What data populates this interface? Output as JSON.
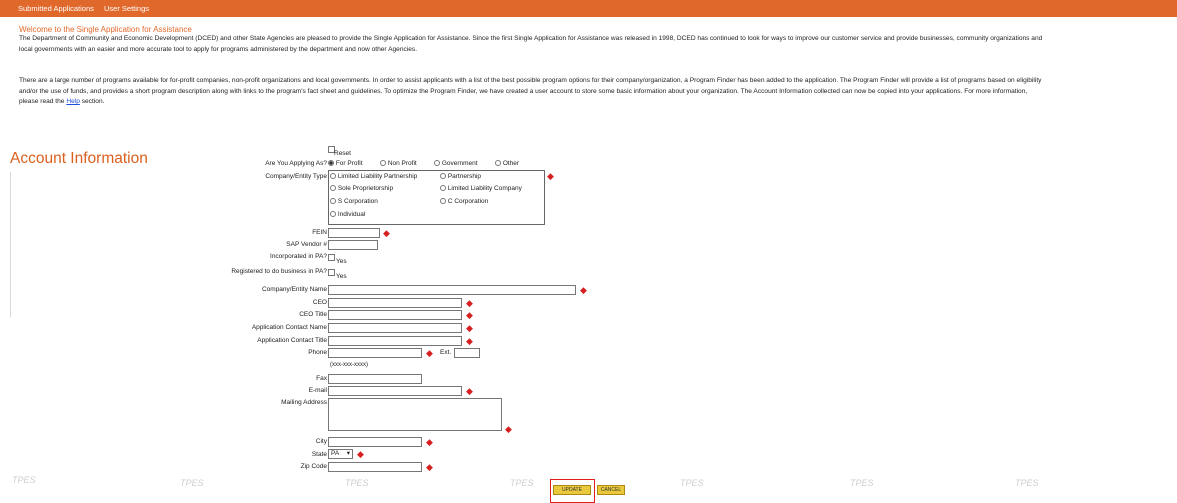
{
  "nav": {
    "submitted_applications": "Submitted Applications",
    "user_settings": "User Settings"
  },
  "welcome": {
    "title": "Welcome to the Single Application for Assistance",
    "para1_line1": "The Department of Community and Economic Development (DCED) and other State Agencies are pleased to provide the Single Application for Assistance.  Since the first Single Application for Assistance was released in 1998, DCED has continued to look for ways to improve our customer service and provide businesses, community organizations and",
    "para1_line2": "local governments with an easier and more accurate tool to apply for programs administered by the department and now other Agencies.",
    "para2_line1": "There are a large number of programs available for for-profit companies, non-profit organizations and local governments.  In order to assist applicants with a list of the best possible program options for their company/organization, a Program Finder has been added to the application.  The Program Finder will provide a list of programs based on eligibility",
    "para2_line2": "and/or the use of funds, and provides a short program description along with links to the program's fact sheet and guidelines.  To optimize the Program Finder, we have created a user account to store some basic information about your organization.  The Account Information collected can now be copied into your applications.  For more information,",
    "para2_line3_prefix": "please read the",
    "help_link": "Help",
    "para2_line3_suffix": "section."
  },
  "section_title": "Account Information",
  "form": {
    "reset_label": "Reset",
    "applying_as_label": "Are You Applying As?",
    "applying_as_options": [
      "For Profit",
      "Non Profit",
      "Government",
      "Other"
    ],
    "applying_as_selected": "For Profit",
    "entity_type_label": "Company/Entity Type",
    "entity_types": [
      "Limited Liability Partnership",
      "Partnership",
      "Sole Proprietorship",
      "Limited Liability Company",
      "S Corporation",
      "C Corporation",
      "Individual"
    ],
    "fein_label": "FEIN",
    "sap_vendor_label": "SAP Vendor #",
    "incorporated_label": "Incorporated in PA?",
    "registered_label": "Registered to do business in PA?",
    "yes_label": "Yes",
    "company_name_label": "Company/Entity Name",
    "ceo_label": "CEO",
    "ceo_title_label": "CEO Title",
    "app_contact_name_label": "Application Contact Name",
    "app_contact_title_label": "Application Contact Title",
    "phone_label": "Phone",
    "ext_label": "Ext.",
    "phone_hint": "(xxx-xxx-xxxx)",
    "fax_label": "Fax",
    "email_label": "E-mail",
    "mailing_address_label": "Mailing Address",
    "city_label": "City",
    "state_label": "State",
    "state_value": "PA",
    "zip_label": "Zip Code"
  },
  "buttons": {
    "update": "UPDATE",
    "cancel": "CANCEL"
  },
  "watermark": "TPES",
  "colors": {
    "topbar": "#e0682b",
    "title": "#d9601f",
    "required": "#d62020",
    "button": "#e9c83c",
    "highlight": "#e11d1d"
  }
}
